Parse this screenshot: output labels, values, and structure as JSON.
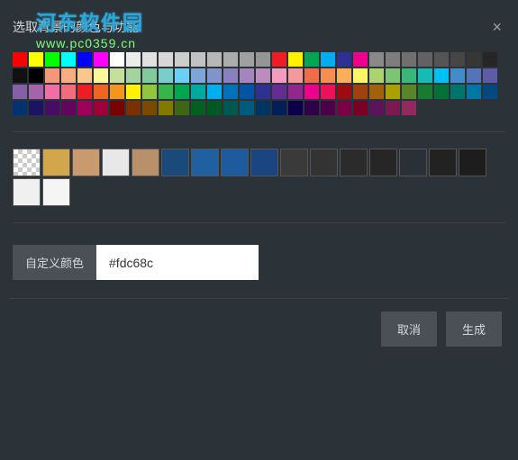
{
  "title": "选取背景的颜色与功能",
  "watermark": {
    "host": "河东软件园",
    "url": "www.pc0359.cn"
  },
  "colors": [
    "#ff0000",
    "#ffff00",
    "#00ff00",
    "#00ffff",
    "#0000ff",
    "#ff00ff",
    "#ffffff",
    "#ebebeb",
    "#e1e1e1",
    "#d7d7d7",
    "#cccccc",
    "#c2c2c2",
    "#b7b7b7",
    "#acacac",
    "#a0a0a0",
    "#959595",
    "#ee1d24",
    "#fff100",
    "#00a650",
    "#00aeef",
    "#2f3192",
    "#ed008c",
    "#898989",
    "#7d7d7d",
    "#707070",
    "#626262",
    "#555555",
    "#464646",
    "#363636",
    "#262626",
    "#111111",
    "#000000",
    "#f7977a",
    "#fbad82",
    "#fdc68c",
    "#fff799",
    "#c6df9c",
    "#a4d49d",
    "#81ca9d",
    "#7bcdc9",
    "#6ccff7",
    "#7ca6d8",
    "#8293ca",
    "#8881be",
    "#a286bd",
    "#bc8cbf",
    "#f49bc1",
    "#f5999d",
    "#f16c4d",
    "#f68e54",
    "#fbaf5a",
    "#fff467",
    "#acd372",
    "#7dc473",
    "#39b778",
    "#16bcb4",
    "#00bff3",
    "#438ccb",
    "#5573b7",
    "#5e5ca7",
    "#855fa8",
    "#a763a9",
    "#ef6ea8",
    "#f16d7e",
    "#ee1d24",
    "#f16522",
    "#f7941d",
    "#fff100",
    "#8fc63d",
    "#37b44a",
    "#00a650",
    "#00a99e",
    "#00aeef",
    "#0072bc",
    "#0054a5",
    "#2f3192",
    "#652c91",
    "#91278f",
    "#ed008c",
    "#ee105a",
    "#9d0a0f",
    "#a1410d",
    "#a36209",
    "#aba000",
    "#588528",
    "#197b30",
    "#007236",
    "#00736a",
    "#0076a4",
    "#004a80",
    "#003370",
    "#1d1363",
    "#450e61",
    "#62055f",
    "#9e005c",
    "#9d0039",
    "#790000",
    "#7b3000",
    "#7c4900",
    "#827a00",
    "#3e6617",
    "#045f20",
    "#005824",
    "#005951",
    "#005b7e",
    "#003562",
    "#002056",
    "#0c004b",
    "#30004a",
    "#4b0048",
    "#7a0045",
    "#7a0026",
    "#5c135c",
    "#7a1a52",
    "#912b5f"
  ],
  "textures": [
    "checker",
    "#d4a64c",
    "#c89a6e",
    "#e8e8e8",
    "#b8916b",
    "#1a4a7a",
    "#2060a0",
    "#1e5a9e",
    "#1a4580",
    "#3a3a3a",
    "#333333",
    "#2b2b2b",
    "#262626",
    "#2a3038",
    "#222222",
    "#1d1d1d",
    "#f0f0f0",
    "#f5f5f5"
  ],
  "custom": {
    "label": "自定义颜色",
    "value": "#fdc68c"
  },
  "buttons": {
    "cancel": "取消",
    "generate": "生成"
  }
}
